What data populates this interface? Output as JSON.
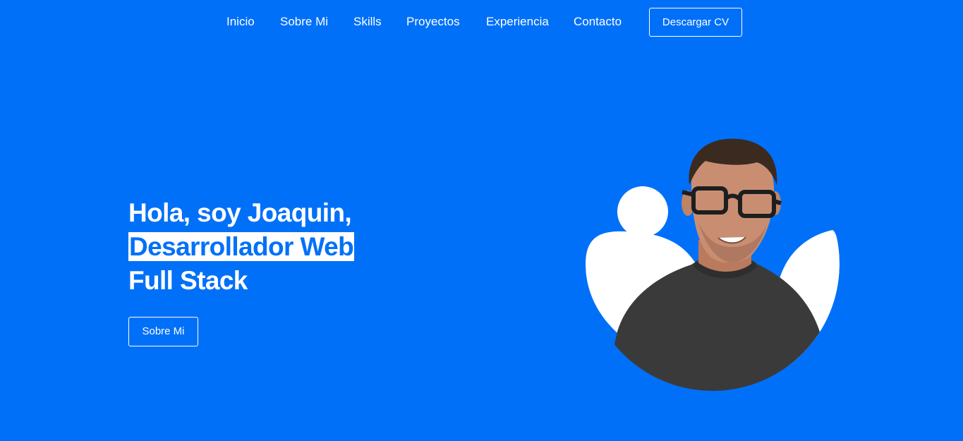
{
  "nav": {
    "links": [
      {
        "label": "Inicio"
      },
      {
        "label": "Sobre Mi"
      },
      {
        "label": "Skills"
      },
      {
        "label": "Proyectos"
      },
      {
        "label": "Experiencia"
      },
      {
        "label": "Contacto"
      }
    ],
    "cv_button_label": "Descargar CV"
  },
  "hero": {
    "line1": "Hola, soy Joaquin,",
    "line2_highlight": "Desarrollador Web",
    "line3": "Full Stack",
    "button_label": "Sobre Mi"
  },
  "colors": {
    "background": "#0070f9",
    "text": "#ffffff",
    "highlight_bg": "#ffffff",
    "highlight_text": "#0070f9",
    "shirt": "#3a3a3a",
    "skin": "#c98e72",
    "hair": "#3b2a20"
  },
  "portrait": {
    "icon": "person-photo"
  }
}
